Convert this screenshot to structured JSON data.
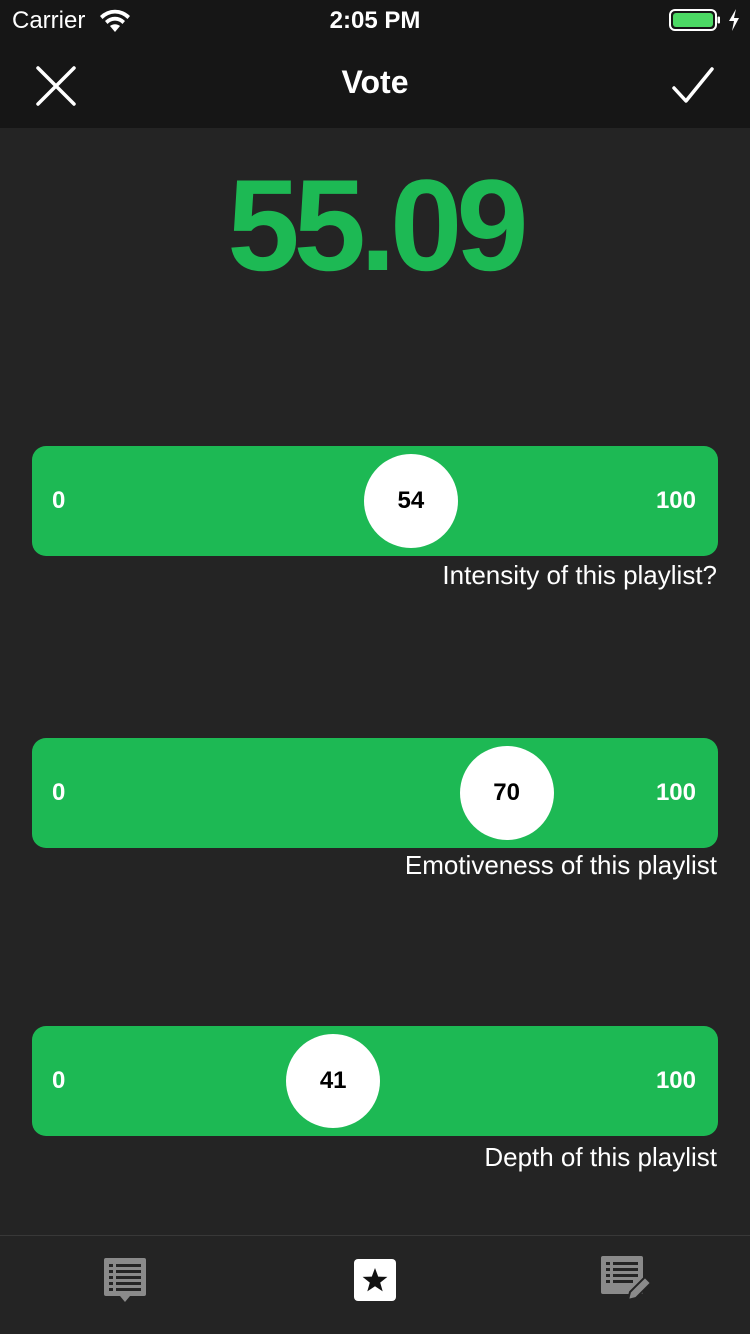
{
  "status_bar": {
    "carrier": "Carrier",
    "time": "2:05 PM",
    "icons": [
      "wifi-icon",
      "battery-icon",
      "charging-bolt-icon"
    ]
  },
  "nav": {
    "title": "Vote",
    "left_icon": "close-icon",
    "right_icon": "checkmark-icon"
  },
  "score": "55.09",
  "colors": {
    "accent": "#1db954",
    "score_text": "#1db954",
    "background": "#242424",
    "bar": "#161616"
  },
  "sliders": [
    {
      "min": "0",
      "max": "100",
      "value": "54",
      "caption": "Intensity of this playlist?"
    },
    {
      "min": "0",
      "max": "100",
      "value": "70",
      "caption": "Emotiveness of this playlist"
    },
    {
      "min": "0",
      "max": "100",
      "value": "41",
      "caption": "Depth of this playlist"
    }
  ],
  "tab_bar": {
    "tabs": [
      "playlist-comment-icon",
      "star-icon",
      "edit-list-icon"
    ]
  }
}
